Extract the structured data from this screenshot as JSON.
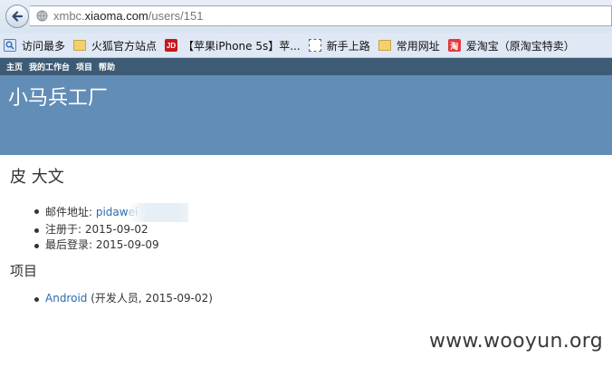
{
  "browser": {
    "url_prefix": "xmbc.",
    "url_host": "xiaoma.com",
    "url_path": "/users/151",
    "bookmarks": [
      {
        "label": "访问最多",
        "icon": "most-visited-icon"
      },
      {
        "label": "火狐官方站点",
        "icon": "folder-icon"
      },
      {
        "label": "【苹果iPhone 5s】苹...",
        "icon": "jd-icon",
        "icon_text": "JD"
      },
      {
        "label": "新手上路",
        "icon": "blank-page-icon"
      },
      {
        "label": "常用网址",
        "icon": "folder-icon"
      },
      {
        "label": "爱淘宝（原淘宝特卖）",
        "icon": "taobao-icon",
        "icon_text": "淘"
      }
    ]
  },
  "site": {
    "nav": [
      "主页",
      "我的工作台",
      "项目",
      "帮助"
    ],
    "title": "小马兵工厂",
    "colors": {
      "topnav": "#3e5b76",
      "header": "#628db6",
      "link": "#2a6bb0"
    }
  },
  "user": {
    "name": "皮 大文",
    "email_label": "邮件地址: ",
    "email_value": "pidawei",
    "registered_label": "注册于: ",
    "registered_value": "2015-09-02",
    "last_login_label": "最后登录: ",
    "last_login_value": "2015-09-09"
  },
  "projects": {
    "heading": "项目",
    "items": [
      {
        "name": "Android",
        "detail": " (开发人员, 2015-09-02)"
      }
    ]
  },
  "watermark": "www.wooyun.org"
}
